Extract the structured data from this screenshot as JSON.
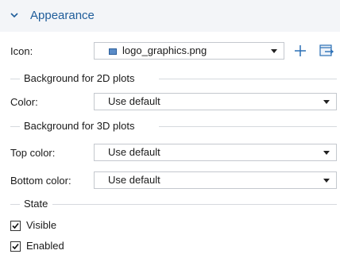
{
  "section": {
    "title": "Appearance",
    "icon_name": "chevron-down-icon"
  },
  "icon_row": {
    "label": "Icon:",
    "value": "logo_graphics.png",
    "image_icon": "image-file-icon",
    "add_icon": "plus-icon",
    "browse_icon": "browse-import-icon"
  },
  "bg2d": {
    "group_title": "Background for 2D plots",
    "color_label": "Color:",
    "color_value": "Use default"
  },
  "bg3d": {
    "group_title": "Background for 3D plots",
    "top_label": "Top color:",
    "top_value": "Use default",
    "bottom_label": "Bottom color:",
    "bottom_value": "Use default"
  },
  "state": {
    "group_title": "State",
    "visible_label": "Visible",
    "visible_checked": true,
    "enabled_label": "Enabled",
    "enabled_checked": true
  },
  "colors": {
    "accent": "#1f5d9a",
    "header_bg": "#f3f5f8",
    "border": "#c4c8ce"
  }
}
